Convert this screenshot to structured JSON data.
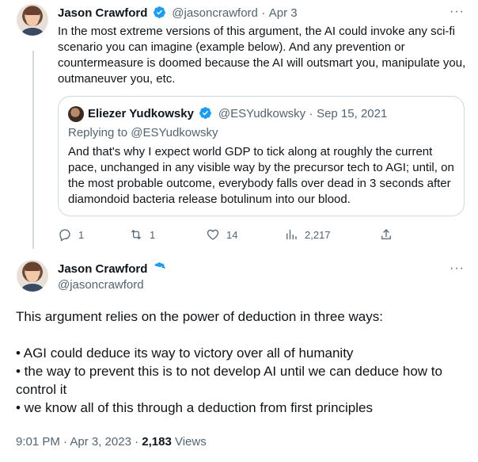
{
  "tweet1": {
    "author_name": "Jason Crawford",
    "handle": "@jasoncrawford",
    "date_sep": "·",
    "date": "Apr 3",
    "more": "···",
    "body": "In the most extreme versions of this argument, the AI could invoke any sci-fi scenario you can imagine (example below). And any prevention or countermeasure is doomed because the AI will outsmart you, manipulate you, outmaneuver you, etc."
  },
  "quote": {
    "author_name": "Eliezer Yudkowsky",
    "handle": "@ESYudkowsky",
    "date_sep": "·",
    "date": "Sep 15, 2021",
    "replying_to": "Replying to @ESYudkowsky",
    "body": "And that's why I expect world GDP to tick along at roughly the current pace, unchanged in any visible way by the precursor tech to AGI; until, on the most probable outcome, everybody falls over dead in 3 seconds after diamondoid bacteria release botulinum into our blood."
  },
  "actions": {
    "replies": "1",
    "retweets": "1",
    "likes": "14",
    "views": "2,217"
  },
  "tweet2": {
    "author_name": "Jason Crawford",
    "handle": "@jasoncrawford",
    "more": "···",
    "intro": "This argument relies on the power of deduction in three ways:",
    "bullets": [
      "• AGI could deduce its way to victory over all of humanity",
      "• the way to prevent this is to not develop AI until we can deduce how to control it",
      "• we know all of this through a deduction from first principles"
    ],
    "timestamp": "9:01 PM · Apr 3, 2023 · ",
    "views_count": "2,183",
    "views_label": " Views"
  },
  "colors": {
    "verified_blue": "#1d9bf0",
    "muted": "#536471",
    "text": "#0f1419",
    "border": "#cfd9de"
  }
}
